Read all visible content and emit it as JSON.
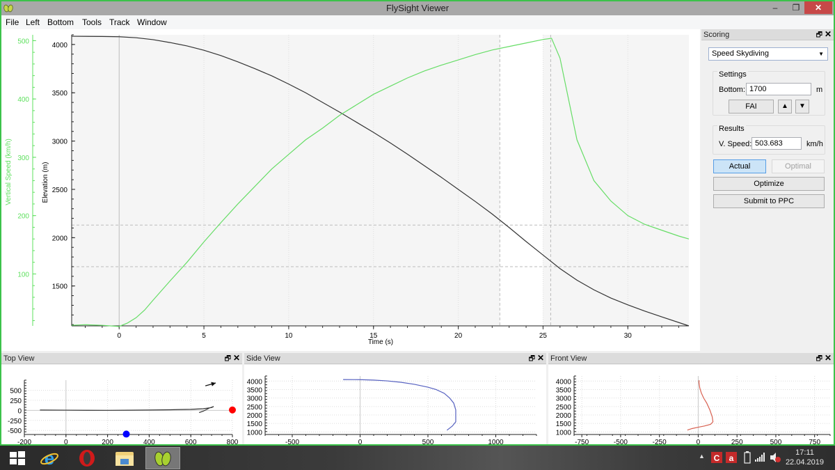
{
  "window": {
    "title": "FlySight Viewer",
    "controls": {
      "minimize": "–",
      "maximize": "❐",
      "close": "✕"
    }
  },
  "menu": [
    "File",
    "Left",
    "Bottom",
    "Tools",
    "Track",
    "Window"
  ],
  "main_chart": {
    "left_axis_speed": {
      "label": "Vertical Speed (km/h)",
      "ticks": [
        "500",
        "400",
        "300",
        "200",
        "100"
      ],
      "color": "#5ee05e"
    },
    "left_axis_elev": {
      "label": "Elevation (m)",
      "ticks": [
        "4000",
        "3500",
        "3000",
        "2500",
        "2000",
        "1500"
      ]
    },
    "x_axis": {
      "label": "Time (s)",
      "ticks": [
        "0",
        "5",
        "10",
        "15",
        "20",
        "25",
        "30"
      ]
    }
  },
  "chart_data": [
    {
      "type": "line",
      "title": "",
      "xlabel": "Time (s)",
      "ylabel": "Elevation (m)",
      "y2label": "Vertical Speed (km/h)",
      "xlim": [
        -2.8,
        33.6
      ],
      "ylim": [
        1087,
        4100
      ],
      "y2lim": [
        11,
        510
      ],
      "grid": true,
      "window_marks": {
        "start_time": 22.45,
        "end_time": 25.45,
        "top_elevation": 2130,
        "bottom_elevation": 1700
      },
      "white_band_time": [
        22.45,
        25.0
      ],
      "series": [
        {
          "name": "Elevation",
          "axis": "left",
          "color": "#333333",
          "x": [
            -2.8,
            -1,
            0,
            1,
            2,
            3,
            4,
            5,
            6,
            7,
            8,
            9,
            10,
            11,
            12,
            13,
            14,
            15,
            16,
            17,
            18,
            19,
            20,
            21,
            22,
            23,
            24,
            25,
            26,
            27,
            28,
            29,
            30,
            31,
            32,
            33.6
          ],
          "y": [
            4085,
            4083,
            4080,
            4070,
            4050,
            4020,
            3985,
            3940,
            3885,
            3820,
            3750,
            3675,
            3590,
            3500,
            3400,
            3300,
            3195,
            3090,
            2980,
            2865,
            2745,
            2625,
            2500,
            2375,
            2245,
            2105,
            1960,
            1820,
            1680,
            1560,
            1460,
            1375,
            1305,
            1240,
            1180,
            1087
          ]
        },
        {
          "name": "Vertical Speed",
          "axis": "right",
          "color": "#66dd66",
          "x": [
            -2.8,
            -2,
            -1,
            0,
            0.5,
            1,
            1.5,
            2,
            3,
            4,
            5,
            6,
            7,
            8,
            9,
            10,
            11,
            12,
            13,
            14,
            15,
            16,
            17,
            18,
            19,
            20,
            21,
            22,
            23,
            24,
            25,
            25.5,
            26,
            26.5,
            27,
            28,
            29,
            30,
            31,
            32,
            33,
            33.6
          ],
          "y": [
            12,
            13,
            12,
            10,
            16,
            25,
            38,
            55,
            88,
            120,
            155,
            188,
            220,
            250,
            280,
            305,
            330,
            350,
            372,
            390,
            408,
            422,
            436,
            448,
            458,
            467,
            476,
            484,
            490,
            496,
            502,
            504,
            470,
            400,
            330,
            260,
            225,
            200,
            185,
            175,
            165,
            160
          ]
        }
      ]
    },
    {
      "type": "line",
      "title": "Top View",
      "xlim": [
        -200,
        800
      ],
      "ylim": [
        -600,
        750
      ],
      "xticks": [
        "-200",
        "0",
        "200",
        "400",
        "600",
        "800"
      ],
      "yticks": [
        "500",
        "250",
        "0",
        "-250",
        "-500"
      ],
      "series": [
        {
          "name": "track",
          "color": "#333333",
          "x": [
            -125,
            0,
            100,
            200,
            300,
            400,
            500,
            600,
            660,
            700,
            710,
            690,
            660,
            640
          ],
          "y": [
            8,
            5,
            2,
            0,
            3,
            8,
            15,
            25,
            40,
            70,
            95,
            60,
            -20,
            -55
          ]
        }
      ],
      "markers": [
        {
          "name": "wind-arrow",
          "x": [
            670,
            720
          ],
          "y": [
            610,
            680
          ],
          "color": "#111111"
        },
        {
          "name": "start-marker",
          "x": 800,
          "y": 10,
          "color": "#ff0000"
        },
        {
          "name": "ground-marker",
          "x": 290,
          "y": -590,
          "color": "#0000ff"
        }
      ]
    },
    {
      "type": "line",
      "title": "Side View",
      "xlim": [
        -700,
        1300
      ],
      "ylim": [
        850,
        4300
      ],
      "xticks": [
        "-500",
        "0",
        "500",
        "1000"
      ],
      "yticks": [
        "4000",
        "3500",
        "3000",
        "2500",
        "2000",
        "1500",
        "1000"
      ],
      "series": [
        {
          "name": "track",
          "color": "#5560c0",
          "x": [
            -125,
            0,
            100,
            200,
            300,
            400,
            500,
            560,
            620,
            660,
            690,
            705,
            705,
            680,
            640
          ],
          "y": [
            4090,
            4085,
            4060,
            4010,
            3930,
            3810,
            3640,
            3500,
            3280,
            3000,
            2700,
            2300,
            1600,
            1350,
            1100
          ]
        }
      ]
    },
    {
      "type": "line",
      "title": "Front View",
      "xlim": [
        -800,
        850
      ],
      "ylim": [
        850,
        4300
      ],
      "xticks": [
        "-750",
        "-500",
        "-250",
        "0",
        "250",
        "500",
        "750"
      ],
      "yticks": [
        "4000",
        "3500",
        "3000",
        "2500",
        "2000",
        "1500",
        "1000"
      ],
      "series": [
        {
          "name": "track",
          "color": "#d86050",
          "x": [
            5,
            5,
            10,
            20,
            35,
            55,
            75,
            90,
            95,
            80,
            40,
            0,
            -40,
            -70
          ],
          "y": [
            4050,
            3900,
            3600,
            3300,
            3000,
            2700,
            2300,
            1900,
            1600,
            1450,
            1350,
            1280,
            1200,
            1110
          ]
        }
      ]
    }
  ],
  "scoring": {
    "title": "Scoring",
    "mode": "Speed Skydiving",
    "settings_title": "Settings",
    "bottom_label": "Bottom:",
    "bottom_value": "1700",
    "bottom_unit": "m",
    "fai_label": "FAI",
    "up_label": "▲",
    "down_label": "▼",
    "results_title": "Results",
    "vspeed_label": "V. Speed:",
    "vspeed_value": "503.683",
    "vspeed_unit": "km/h",
    "actual_label": "Actual",
    "optimal_label": "Optimal",
    "optimize_label": "Optimize",
    "submit_label": "Submit to PPC"
  },
  "docks": {
    "top_view": "Top View",
    "side_view": "Side View",
    "front_view": "Front View",
    "float_icon": "🗗",
    "close_icon": "✕"
  },
  "taskbar": {
    "time": "17:11",
    "date": "22.04.2019",
    "apps": [
      "windows-start",
      "internet-explorer",
      "opera",
      "file-explorer",
      "flysight-viewer"
    ]
  }
}
